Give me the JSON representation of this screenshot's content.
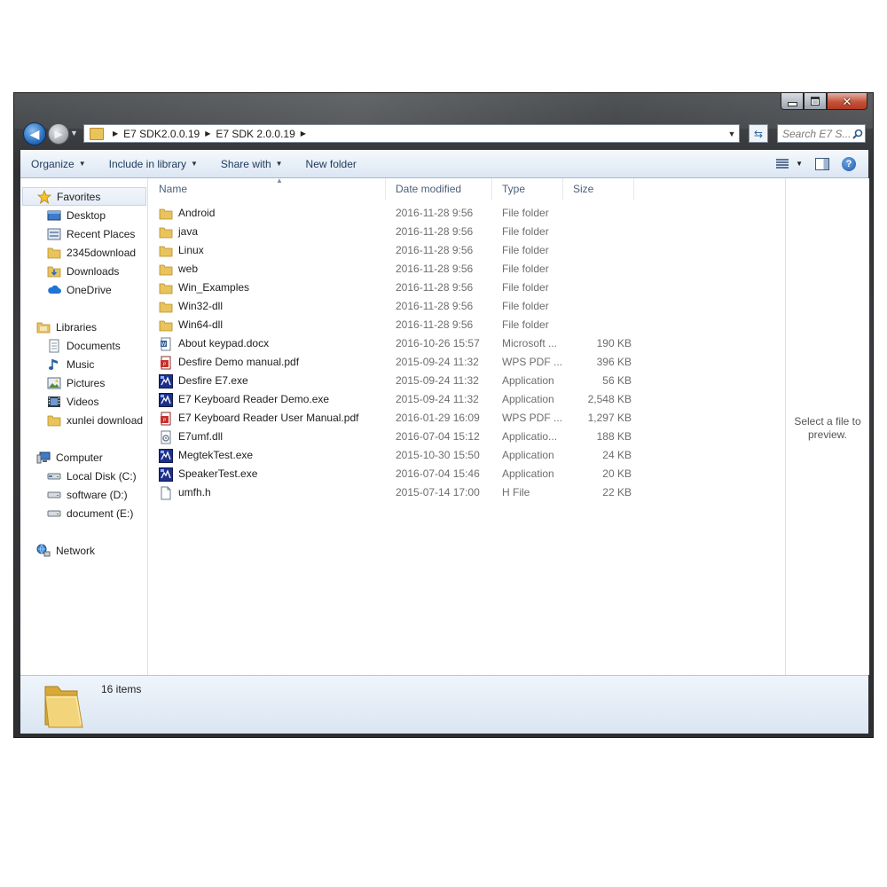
{
  "window": {
    "buttons": {
      "minimize": "minimize",
      "maximize": "maximize",
      "close": "✕"
    }
  },
  "address": {
    "crumbs": [
      "E7 SDK2.0.0.19",
      "E7 SDK 2.0.0.19"
    ],
    "search_placeholder": "Search E7 S..."
  },
  "toolbar": {
    "organize": "Organize",
    "include_in_library": "Include in library",
    "share_with": "Share with",
    "new_folder": "New folder"
  },
  "sidebar": {
    "favorites": {
      "label": "Favorites",
      "items": [
        "Desktop",
        "Recent Places",
        "2345download",
        "Downloads",
        "OneDrive"
      ]
    },
    "libraries": {
      "label": "Libraries",
      "items": [
        "Documents",
        "Music",
        "Pictures",
        "Videos",
        "xunlei download"
      ]
    },
    "computer": {
      "label": "Computer",
      "items": [
        "Local Disk (C:)",
        "software (D:)",
        "document (E:)"
      ]
    },
    "network": {
      "label": "Network"
    }
  },
  "columns": {
    "name": "Name",
    "date": "Date modified",
    "type": "Type",
    "size": "Size"
  },
  "files": [
    {
      "name": "Android",
      "date": "2016-11-28 9:56",
      "type": "File folder",
      "size": "",
      "icon": "folder-icon"
    },
    {
      "name": "java",
      "date": "2016-11-28 9:56",
      "type": "File folder",
      "size": "",
      "icon": "folder-icon"
    },
    {
      "name": "Linux",
      "date": "2016-11-28 9:56",
      "type": "File folder",
      "size": "",
      "icon": "folder-icon"
    },
    {
      "name": "web",
      "date": "2016-11-28 9:56",
      "type": "File folder",
      "size": "",
      "icon": "folder-icon"
    },
    {
      "name": "Win_Examples",
      "date": "2016-11-28 9:56",
      "type": "File folder",
      "size": "",
      "icon": "folder-icon"
    },
    {
      "name": "Win32-dll",
      "date": "2016-11-28 9:56",
      "type": "File folder",
      "size": "",
      "icon": "folder-icon"
    },
    {
      "name": "Win64-dll",
      "date": "2016-11-28 9:56",
      "type": "File folder",
      "size": "",
      "icon": "folder-icon"
    },
    {
      "name": "About keypad.docx",
      "date": "2016-10-26 15:57",
      "type": "Microsoft ...",
      "size": "190 KB",
      "icon": "docx-icon"
    },
    {
      "name": "Desfire Demo manual.pdf",
      "date": "2015-09-24 11:32",
      "type": "WPS PDF ...",
      "size": "396 KB",
      "icon": "pdf-icon"
    },
    {
      "name": "Desfire E7.exe",
      "date": "2015-09-24 11:32",
      "type": "Application",
      "size": "56 KB",
      "icon": "exe-icon"
    },
    {
      "name": "E7 Keyboard Reader Demo.exe",
      "date": "2015-09-24 11:32",
      "type": "Application",
      "size": "2,548 KB",
      "icon": "exe-icon"
    },
    {
      "name": "E7 Keyboard Reader User Manual.pdf",
      "date": "2016-01-29 16:09",
      "type": "WPS PDF ...",
      "size": "1,297 KB",
      "icon": "pdf-icon"
    },
    {
      "name": "E7umf.dll",
      "date": "2016-07-04 15:12",
      "type": "Applicatio...",
      "size": "188 KB",
      "icon": "dll-icon"
    },
    {
      "name": "MegtekTest.exe",
      "date": "2015-10-30 15:50",
      "type": "Application",
      "size": "24 KB",
      "icon": "exe-icon"
    },
    {
      "name": "SpeakerTest.exe",
      "date": "2016-07-04 15:46",
      "type": "Application",
      "size": "20 KB",
      "icon": "exe-icon"
    },
    {
      "name": "umfh.h",
      "date": "2015-07-14 17:00",
      "type": "H File",
      "size": "22 KB",
      "icon": "file-icon"
    }
  ],
  "preview": {
    "text": "Select a file to preview."
  },
  "details": {
    "count": "16 items"
  },
  "colors": {
    "accent": "#1e395b",
    "folder": "#e9c35b",
    "pdf": "#c8302a",
    "exe": "#1c2f8a"
  }
}
